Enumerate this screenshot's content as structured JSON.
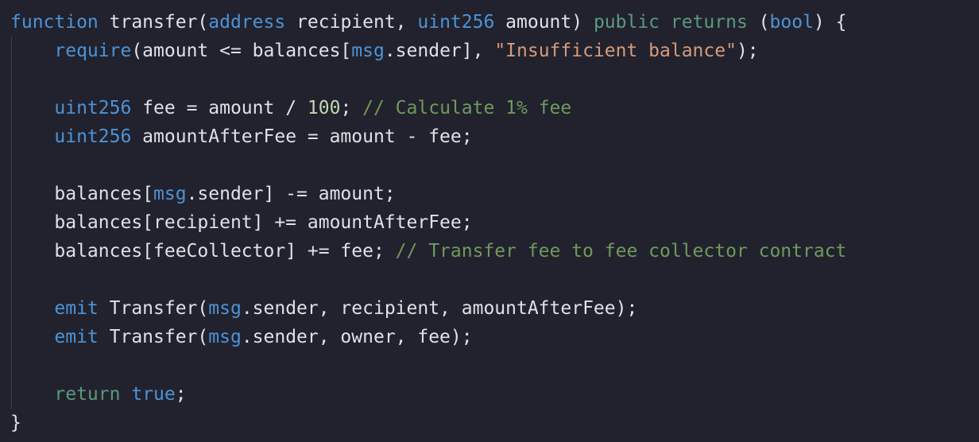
{
  "colors": {
    "background": "#21222e",
    "text": "#e0e0e6",
    "keyword": "#4d93d6",
    "visibility": "#5a9a7a",
    "string": "#d79a7a",
    "number": "#bfd8b0",
    "comment": "#6f9a5a"
  },
  "code_lines": [
    [
      {
        "t": "function",
        "c": "t-kw"
      },
      {
        "t": " transfer(",
        "c": "t-plain"
      },
      {
        "t": "address",
        "c": "t-kw"
      },
      {
        "t": " recipient, ",
        "c": "t-plain"
      },
      {
        "t": "uint256",
        "c": "t-kw"
      },
      {
        "t": " amount) ",
        "c": "t-plain"
      },
      {
        "t": "public",
        "c": "t-kw2"
      },
      {
        "t": " ",
        "c": "t-plain"
      },
      {
        "t": "returns",
        "c": "t-kw2"
      },
      {
        "t": " (",
        "c": "t-plain"
      },
      {
        "t": "bool",
        "c": "t-kw"
      },
      {
        "t": ") {",
        "c": "t-plain"
      }
    ],
    [
      {
        "t": "    ",
        "c": "t-plain"
      },
      {
        "t": "require",
        "c": "t-kw"
      },
      {
        "t": "(amount <= balances[",
        "c": "t-plain"
      },
      {
        "t": "msg",
        "c": "t-kw"
      },
      {
        "t": ".sender], ",
        "c": "t-plain"
      },
      {
        "t": "\"Insufficient balance\"",
        "c": "t-str"
      },
      {
        "t": ");",
        "c": "t-plain"
      }
    ],
    [],
    [
      {
        "t": "    ",
        "c": "t-plain"
      },
      {
        "t": "uint256",
        "c": "t-kw"
      },
      {
        "t": " fee = amount / ",
        "c": "t-plain"
      },
      {
        "t": "100",
        "c": "t-num"
      },
      {
        "t": "; ",
        "c": "t-plain"
      },
      {
        "t": "// Calculate 1% fee",
        "c": "t-cmt"
      }
    ],
    [
      {
        "t": "    ",
        "c": "t-plain"
      },
      {
        "t": "uint256",
        "c": "t-kw"
      },
      {
        "t": " amountAfterFee = amount - fee;",
        "c": "t-plain"
      }
    ],
    [],
    [
      {
        "t": "    balances[",
        "c": "t-plain"
      },
      {
        "t": "msg",
        "c": "t-kw"
      },
      {
        "t": ".sender] -= amount;",
        "c": "t-plain"
      }
    ],
    [
      {
        "t": "    balances[recipient] += amountAfterFee;",
        "c": "t-plain"
      }
    ],
    [
      {
        "t": "    balances[feeCollector] += fee; ",
        "c": "t-plain"
      },
      {
        "t": "// Transfer fee to fee collector contract",
        "c": "t-cmt"
      }
    ],
    [],
    [
      {
        "t": "    ",
        "c": "t-plain"
      },
      {
        "t": "emit",
        "c": "t-kw"
      },
      {
        "t": " Transfer(",
        "c": "t-plain"
      },
      {
        "t": "msg",
        "c": "t-kw"
      },
      {
        "t": ".sender, recipient, amountAfterFee);",
        "c": "t-plain"
      }
    ],
    [
      {
        "t": "    ",
        "c": "t-plain"
      },
      {
        "t": "emit",
        "c": "t-kw"
      },
      {
        "t": " Transfer(",
        "c": "t-plain"
      },
      {
        "t": "msg",
        "c": "t-kw"
      },
      {
        "t": ".sender, owner, fee);",
        "c": "t-plain"
      }
    ],
    [],
    [
      {
        "t": "    ",
        "c": "t-plain"
      },
      {
        "t": "return",
        "c": "t-kw2"
      },
      {
        "t": " ",
        "c": "t-plain"
      },
      {
        "t": "true",
        "c": "t-bool"
      },
      {
        "t": ";",
        "c": "t-plain"
      }
    ],
    [
      {
        "t": "}",
        "c": "t-plain"
      }
    ]
  ]
}
